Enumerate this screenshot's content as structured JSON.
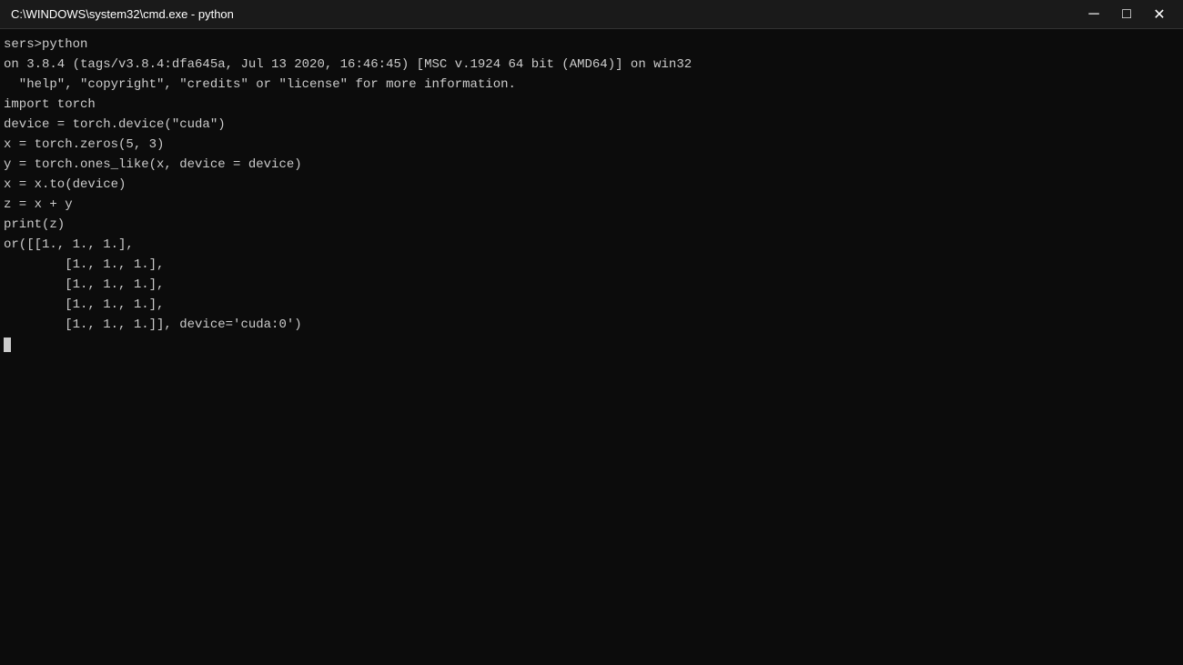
{
  "titleBar": {
    "title": "C:\\WINDOWS\\system32\\cmd.exe - python",
    "minimizeLabel": "─",
    "maximizeLabel": "□",
    "closeLabel": "✕"
  },
  "terminal": {
    "lines": [
      "sers>python",
      "on 3.8.4 (tags/v3.8.4:dfa645a, Jul 13 2020, 16:46:45) [MSC v.1924 64 bit (AMD64)] on win32",
      "  \"help\", \"copyright\", \"credits\" or \"license\" for more information.",
      "import torch",
      "device = torch.device(\"cuda\")",
      "x = torch.zeros(5, 3)",
      "y = torch.ones_like(x, device = device)",
      "x = x.to(device)",
      "z = x + y",
      "print(z)",
      "or([[1., 1., 1.],",
      "        [1., 1., 1.],",
      "        [1., 1., 1.],",
      "        [1., 1., 1.],",
      "        [1., 1., 1.]], device='cuda:0')"
    ]
  }
}
